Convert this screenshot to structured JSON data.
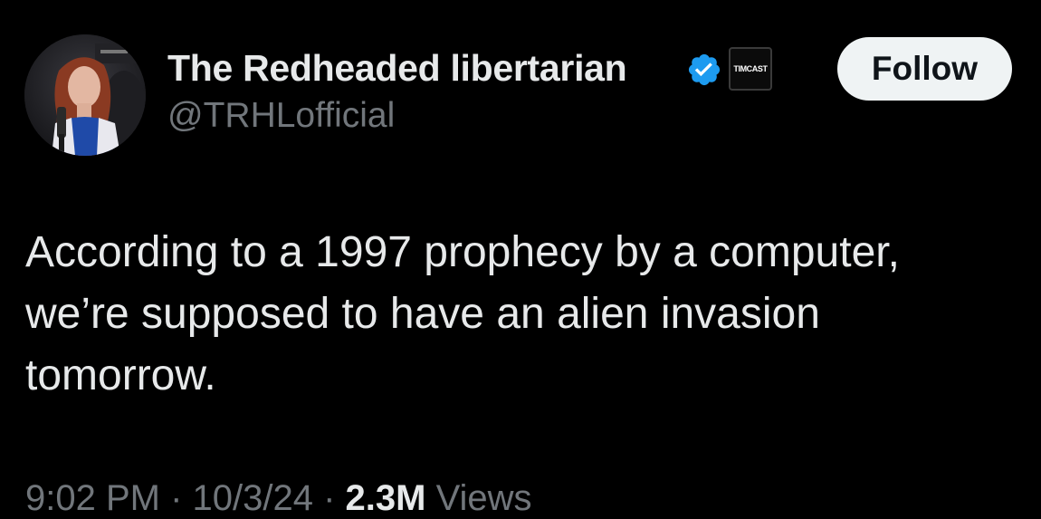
{
  "author": {
    "display_name": "The Redheaded libertarian",
    "handle": "@TRHLofficial",
    "verified_color": "#1d9bf0",
    "affiliate_label": "TIMCAST"
  },
  "actions": {
    "follow_label": "Follow"
  },
  "tweet": {
    "text": "According to a 1997 prophecy by a computer,\nwe’re supposed to have an alien invasion\ntomorrow."
  },
  "meta": {
    "time": "9:02 PM",
    "separator": " · ",
    "date": "10/3/24",
    "views_count": "2.3M",
    "views_label": " Views"
  },
  "colors": {
    "background": "#000000",
    "primary_text": "#e7e9ea",
    "secondary_text": "#71767b",
    "follow_bg": "#eff3f4"
  }
}
